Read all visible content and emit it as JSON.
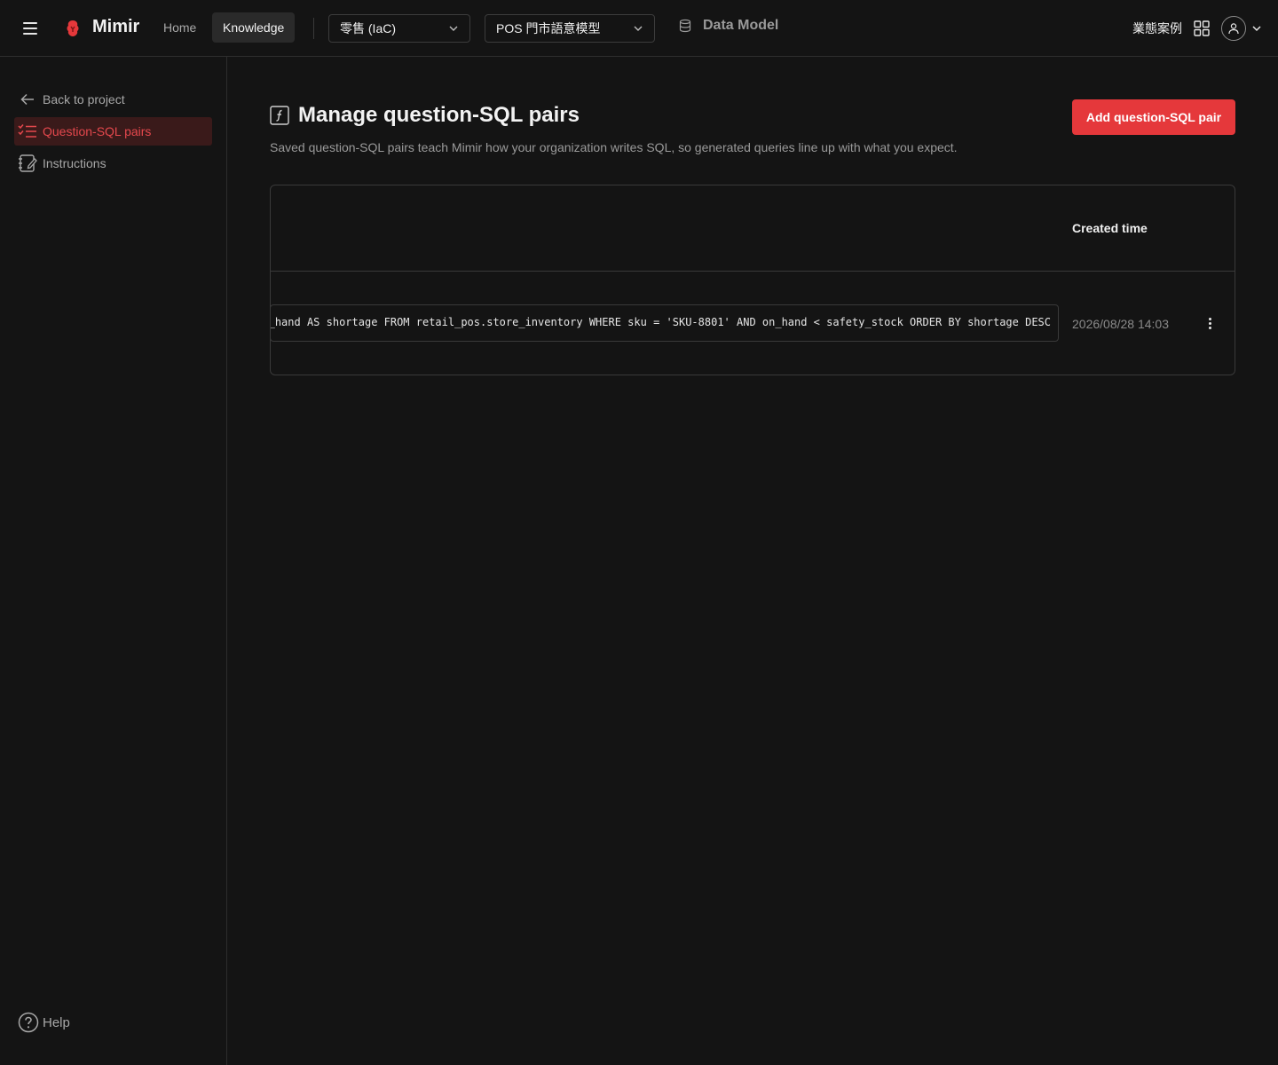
{
  "header": {
    "brand": "Mimir",
    "nav": {
      "home": "Home",
      "knowledge": "Knowledge"
    },
    "industry_select": {
      "value": "零售 (IaC)"
    },
    "model_select": {
      "value": "POS 門市語意模型"
    },
    "data_model_label": "Data Model",
    "right_label": "業態案例",
    "icons": [
      "menu-icon",
      "mimir-logo",
      "chevron-down-icon",
      "database-icon",
      "apps-grid-icon",
      "user-icon"
    ]
  },
  "sidebar": {
    "back_label": "Back to project",
    "items": [
      {
        "label": "Question-SQL pairs",
        "active": true,
        "icon": "checklist-icon"
      },
      {
        "label": "Instructions",
        "active": false,
        "icon": "notebook-edit-icon"
      }
    ],
    "help_label": "Help"
  },
  "main": {
    "title": "Manage question-SQL pairs",
    "subtitle": "Saved question-SQL pairs teach Mimir how your organization writes SQL, so generated queries line up with what you expect.",
    "add_button": "Add question-SQL pair",
    "table": {
      "columns": [
        "Created time"
      ],
      "rows": [
        {
          "sql": "_hand AS shortage FROM retail_pos.store_inventory WHERE sku = 'SKU-8801' AND on_hand < safety_stock ORDER BY shortage DESC",
          "created_time": "2026/08/28 14:03"
        }
      ]
    }
  },
  "colors": {
    "accent": "#e5383b",
    "background": "#141414",
    "border": "#3a3a3a",
    "active_bg": "#3a1a1a"
  }
}
